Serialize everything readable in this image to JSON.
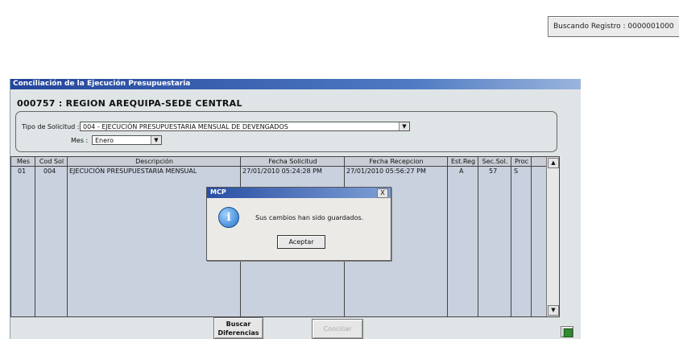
{
  "status": {
    "text": "Buscando Registro : 0000001000"
  },
  "window": {
    "title": "Conciliación de la Ejecución Presupuestaria",
    "entity": "000757 : REGION AREQUIPA-SEDE CENTRAL",
    "tipo_label": "Tipo de Solicitud :",
    "tipo_value": "004 - EJECUCIÓN PRESUPUESTARIA MENSUAL DE DEVENGADOS",
    "mes_label": "Mes :",
    "mes_value": "Enero"
  },
  "grid": {
    "headers": [
      "Mes",
      "Cod Sol",
      "Descripción",
      "Fecha Solicitud",
      "Fecha Recepcion",
      "Est.Reg",
      "Sec.Sol.",
      "Proc"
    ],
    "rows": [
      [
        "01",
        "004",
        "EJECUCIÓN PRESUPUESTARIA MENSUAL",
        "27/01/2010 05:24:28 PM",
        "27/01/2010 05:56:27 PM",
        "A",
        "57",
        "S"
      ]
    ]
  },
  "buttons": {
    "buscar": [
      "Buscar",
      "Diferencias"
    ],
    "conciliar": "Conciliar"
  },
  "dialog": {
    "title": "MCP",
    "message": "Sus cambios han sido guardados.",
    "ok": "Aceptar",
    "close": "X"
  },
  "icons": {
    "info": "information-icon",
    "export": "excel-export-icon"
  }
}
